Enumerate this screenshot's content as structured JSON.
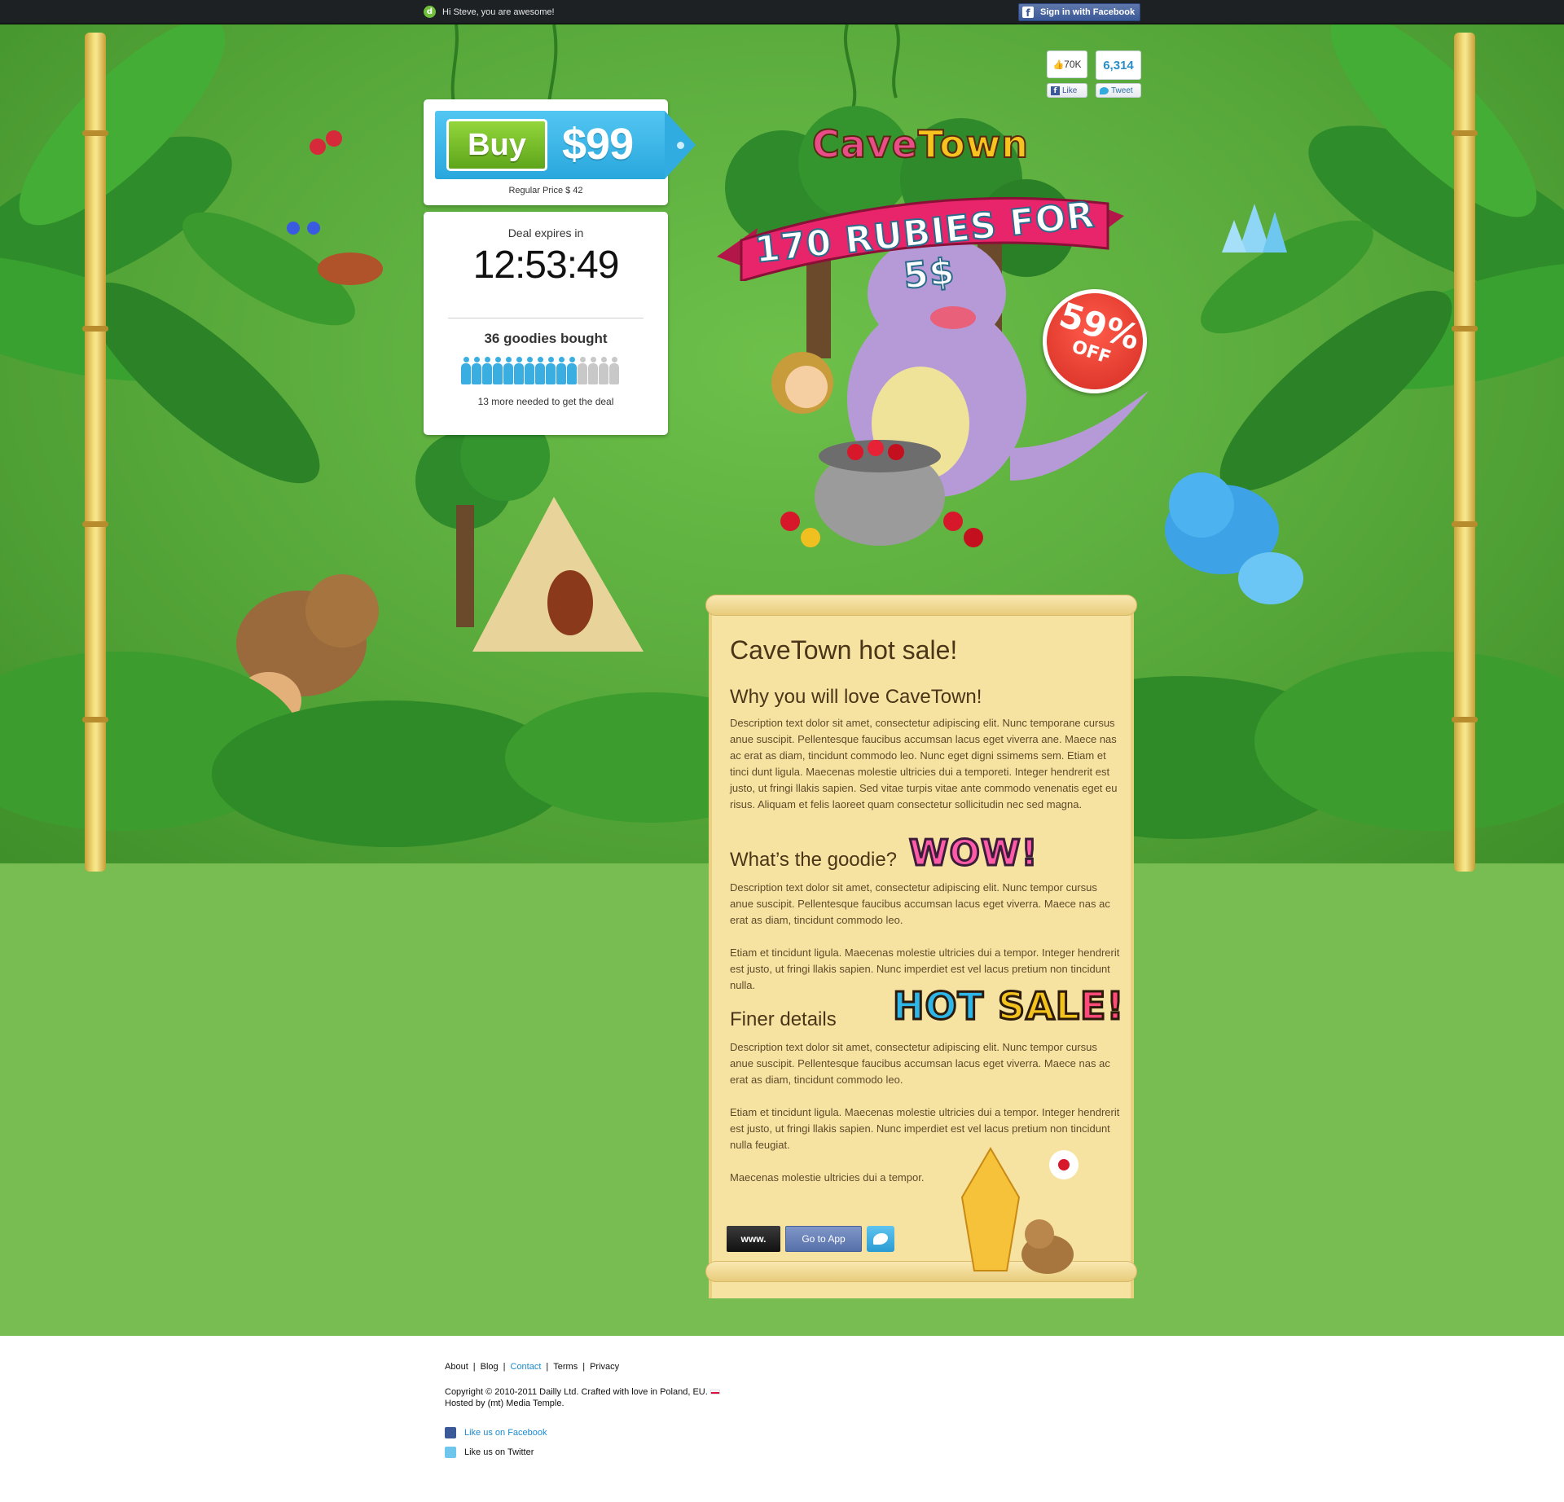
{
  "topbar": {
    "logo_letter": "d",
    "greeting": "Hi Steve, you are awesome!",
    "fb_signin": "Sign in with Facebook",
    "fb_icon": "f"
  },
  "social": {
    "fb_count": "70K",
    "fb_like": "Like",
    "tw_count": "6,314",
    "tw_tweet": "Tweet"
  },
  "deal": {
    "buy_label": "Buy",
    "price": "$99",
    "regular_price": "Regular Price $ 42",
    "expires_label": "Deal expires in",
    "timer": "12:53:49",
    "bought": "36 goodies bought",
    "bought_progress": {
      "filled": 11,
      "total": 15
    },
    "more_needed": "13 more needed to get the deal",
    "accent": "#3aaee0",
    "buy_color": "#6fbf2a"
  },
  "hero": {
    "title_cave": "Cave",
    "title_town": "Town",
    "ribbon": "170 RUBIES FOR 5$",
    "discount_pct": "59%",
    "discount_off": "OFF"
  },
  "article": {
    "title": "CaveTown hot sale!",
    "why_heading": "Why you will love CaveTown!",
    "why_text": "Description text dolor sit amet, consectetur adipiscing elit. Nunc temporane cursus anue suscipit. Pellentesque faucibus accumsan lacus eget viverra ane. Maece nas ac erat as diam, tincidunt commodo leo. Nunc eget digni ssimems sem. Etiam et tinci dunt ligula. Maecenas molestie ultricies dui a temporeti. Integer hendrerit est justo, ut fringi llakis sapien. Sed vitae turpis vitae ante commodo venenatis eget eu risus. Aliquam et felis laoreet quam consectetur sollicitudin nec sed magna.",
    "goodie_heading": "What’s the goodie?",
    "wow": "WOW!",
    "goodie_text_1": "Description text dolor sit amet, consectetur adipiscing elit. Nunc tempor cursus anue suscipit. Pellentesque faucibus accumsan lacus eget viverra. Maece nas ac erat as diam, tincidunt commodo leo.",
    "goodie_text_2": "Etiam et tincidunt ligula. Maecenas molestie ultricies dui a tempor. Integer hendrerit est justo, ut fringi llakis sapien. Nunc imperdiet est vel lacus pretium non tincidunt nulla.",
    "finer_heading": "Finer details",
    "hot_sale_1": "HOT ",
    "hot_sale_2": "SAL",
    "hot_sale_3": "E!",
    "finer_text_1": "Description text dolor sit amet, consectetur adipiscing elit. Nunc tempor cursus anue suscipit. Pellentesque faucibus accumsan lacus eget viverra. Maece nas ac erat as diam, tincidunt commodo leo.",
    "finer_text_2": "Etiam et tincidunt ligula. Maecenas molestie ultricies dui a tempor. Integer hendrerit est justo, ut fringi llakis sapien. Nunc imperdiet est vel lacus pretium non tincidunt nulla feugiat.",
    "finer_text_3": "Maecenas molestie ultricies dui a tempor.",
    "btn_www": "www.",
    "btn_app": "Go to App"
  },
  "footer": {
    "links": {
      "about": "About",
      "blog": "Blog",
      "contact": "Contact",
      "terms": "Terms",
      "privacy": "Privacy"
    },
    "copyright": "Copyright © 2010-2011 Dailly Ltd. Crafted with love in Poland, EU.",
    "hosted": "Hosted by (mt) Media Temple.",
    "fb": "Like us on Facebook",
    "tw": "Like us on Twitter"
  }
}
